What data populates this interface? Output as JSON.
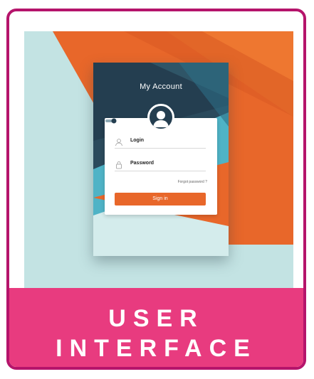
{
  "card": {
    "title": "My Account",
    "login_label": "Login",
    "password_label": "Password",
    "forgot_label": "Forgot password ?",
    "signin_label": "Sign in"
  },
  "banner": {
    "line1": "USER",
    "line2": "INTERFACE"
  },
  "colors": {
    "frame_border": "#b5146b",
    "banner_bg": "#e83b7f",
    "hero_bg": "#c3e3e3",
    "hero_orange": "#e8672a",
    "card_dark": "#243e50",
    "card_blue": "#4fb3c6",
    "button": "#e8672a"
  },
  "icons": [
    "user-avatar-icon",
    "user-icon",
    "lock-icon",
    "toggle-icon"
  ]
}
